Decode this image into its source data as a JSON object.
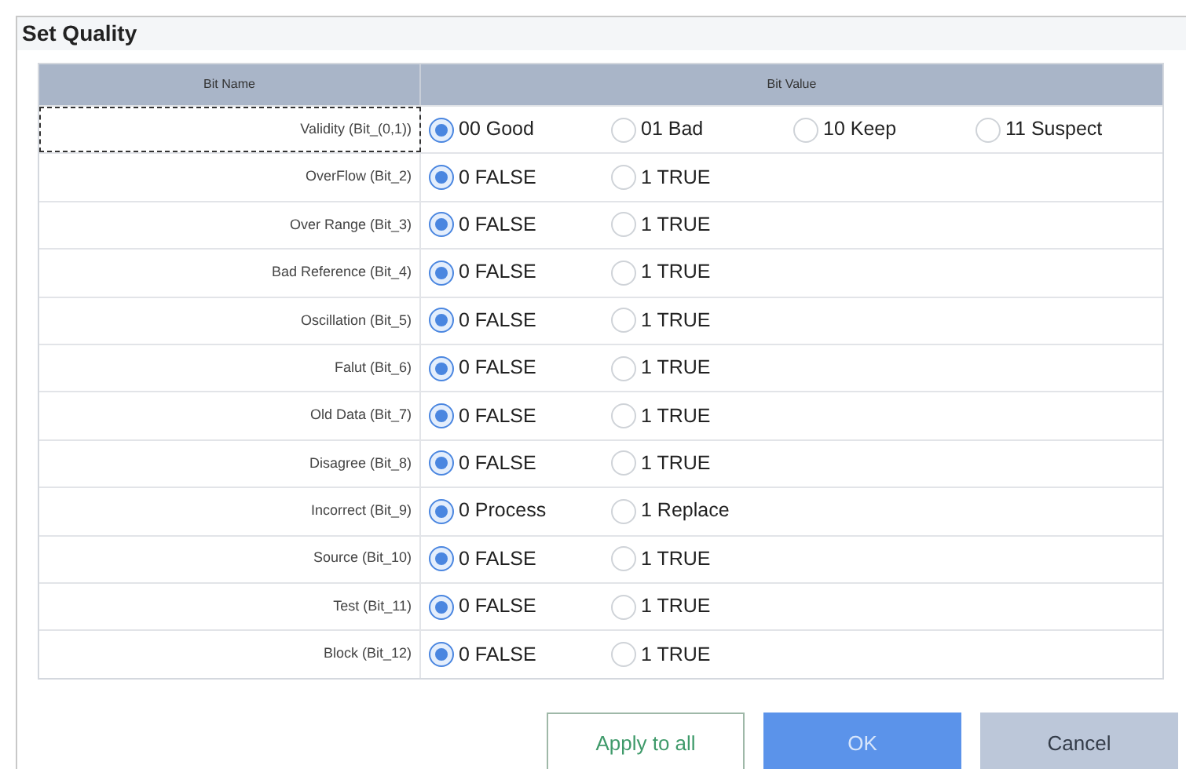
{
  "title": "Set Quality",
  "columns": [
    "Bit Name",
    "Bit Value"
  ],
  "rows": [
    {
      "name": "Validity (Bit_(0,1))",
      "focused": true,
      "options": [
        {
          "label": "00 Good",
          "selected": true
        },
        {
          "label": "01 Bad",
          "selected": false
        },
        {
          "label": "10 Keep",
          "selected": false
        },
        {
          "label": "11 Suspect",
          "selected": false
        }
      ]
    },
    {
      "name": "OverFlow (Bit_2)",
      "focused": false,
      "options": [
        {
          "label": "0 FALSE",
          "selected": true
        },
        {
          "label": "1 TRUE",
          "selected": false
        }
      ]
    },
    {
      "name": "Over Range (Bit_3)",
      "focused": false,
      "options": [
        {
          "label": "0 FALSE",
          "selected": true
        },
        {
          "label": "1 TRUE",
          "selected": false
        }
      ]
    },
    {
      "name": "Bad Reference (Bit_4)",
      "focused": false,
      "options": [
        {
          "label": "0 FALSE",
          "selected": true
        },
        {
          "label": "1 TRUE",
          "selected": false
        }
      ]
    },
    {
      "name": "Oscillation (Bit_5)",
      "focused": false,
      "options": [
        {
          "label": "0 FALSE",
          "selected": true
        },
        {
          "label": "1 TRUE",
          "selected": false
        }
      ]
    },
    {
      "name": "Falut (Bit_6)",
      "focused": false,
      "options": [
        {
          "label": "0 FALSE",
          "selected": true
        },
        {
          "label": "1 TRUE",
          "selected": false
        }
      ]
    },
    {
      "name": "Old Data (Bit_7)",
      "focused": false,
      "options": [
        {
          "label": "0 FALSE",
          "selected": true
        },
        {
          "label": "1 TRUE",
          "selected": false
        }
      ]
    },
    {
      "name": "Disagree (Bit_8)",
      "focused": false,
      "options": [
        {
          "label": "0 FALSE",
          "selected": true
        },
        {
          "label": "1 TRUE",
          "selected": false
        }
      ]
    },
    {
      "name": "Incorrect (Bit_9)",
      "focused": false,
      "options": [
        {
          "label": "0 Process",
          "selected": true
        },
        {
          "label": "1 Replace",
          "selected": false
        }
      ]
    },
    {
      "name": "Source (Bit_10)",
      "focused": false,
      "options": [
        {
          "label": "0 FALSE",
          "selected": true
        },
        {
          "label": "1 TRUE",
          "selected": false
        }
      ]
    },
    {
      "name": "Test (Bit_11)",
      "focused": false,
      "options": [
        {
          "label": "0 FALSE",
          "selected": true
        },
        {
          "label": "1 TRUE",
          "selected": false
        }
      ]
    },
    {
      "name": "Block (Bit_12)",
      "focused": false,
      "options": [
        {
          "label": "0 FALSE",
          "selected": true
        },
        {
          "label": "1 TRUE",
          "selected": false
        }
      ]
    }
  ],
  "buttons": [
    {
      "label": "Apply to all",
      "kind": "outline"
    },
    {
      "label": "OK",
      "kind": "primary"
    },
    {
      "label": "Cancel",
      "kind": "secondary"
    }
  ]
}
